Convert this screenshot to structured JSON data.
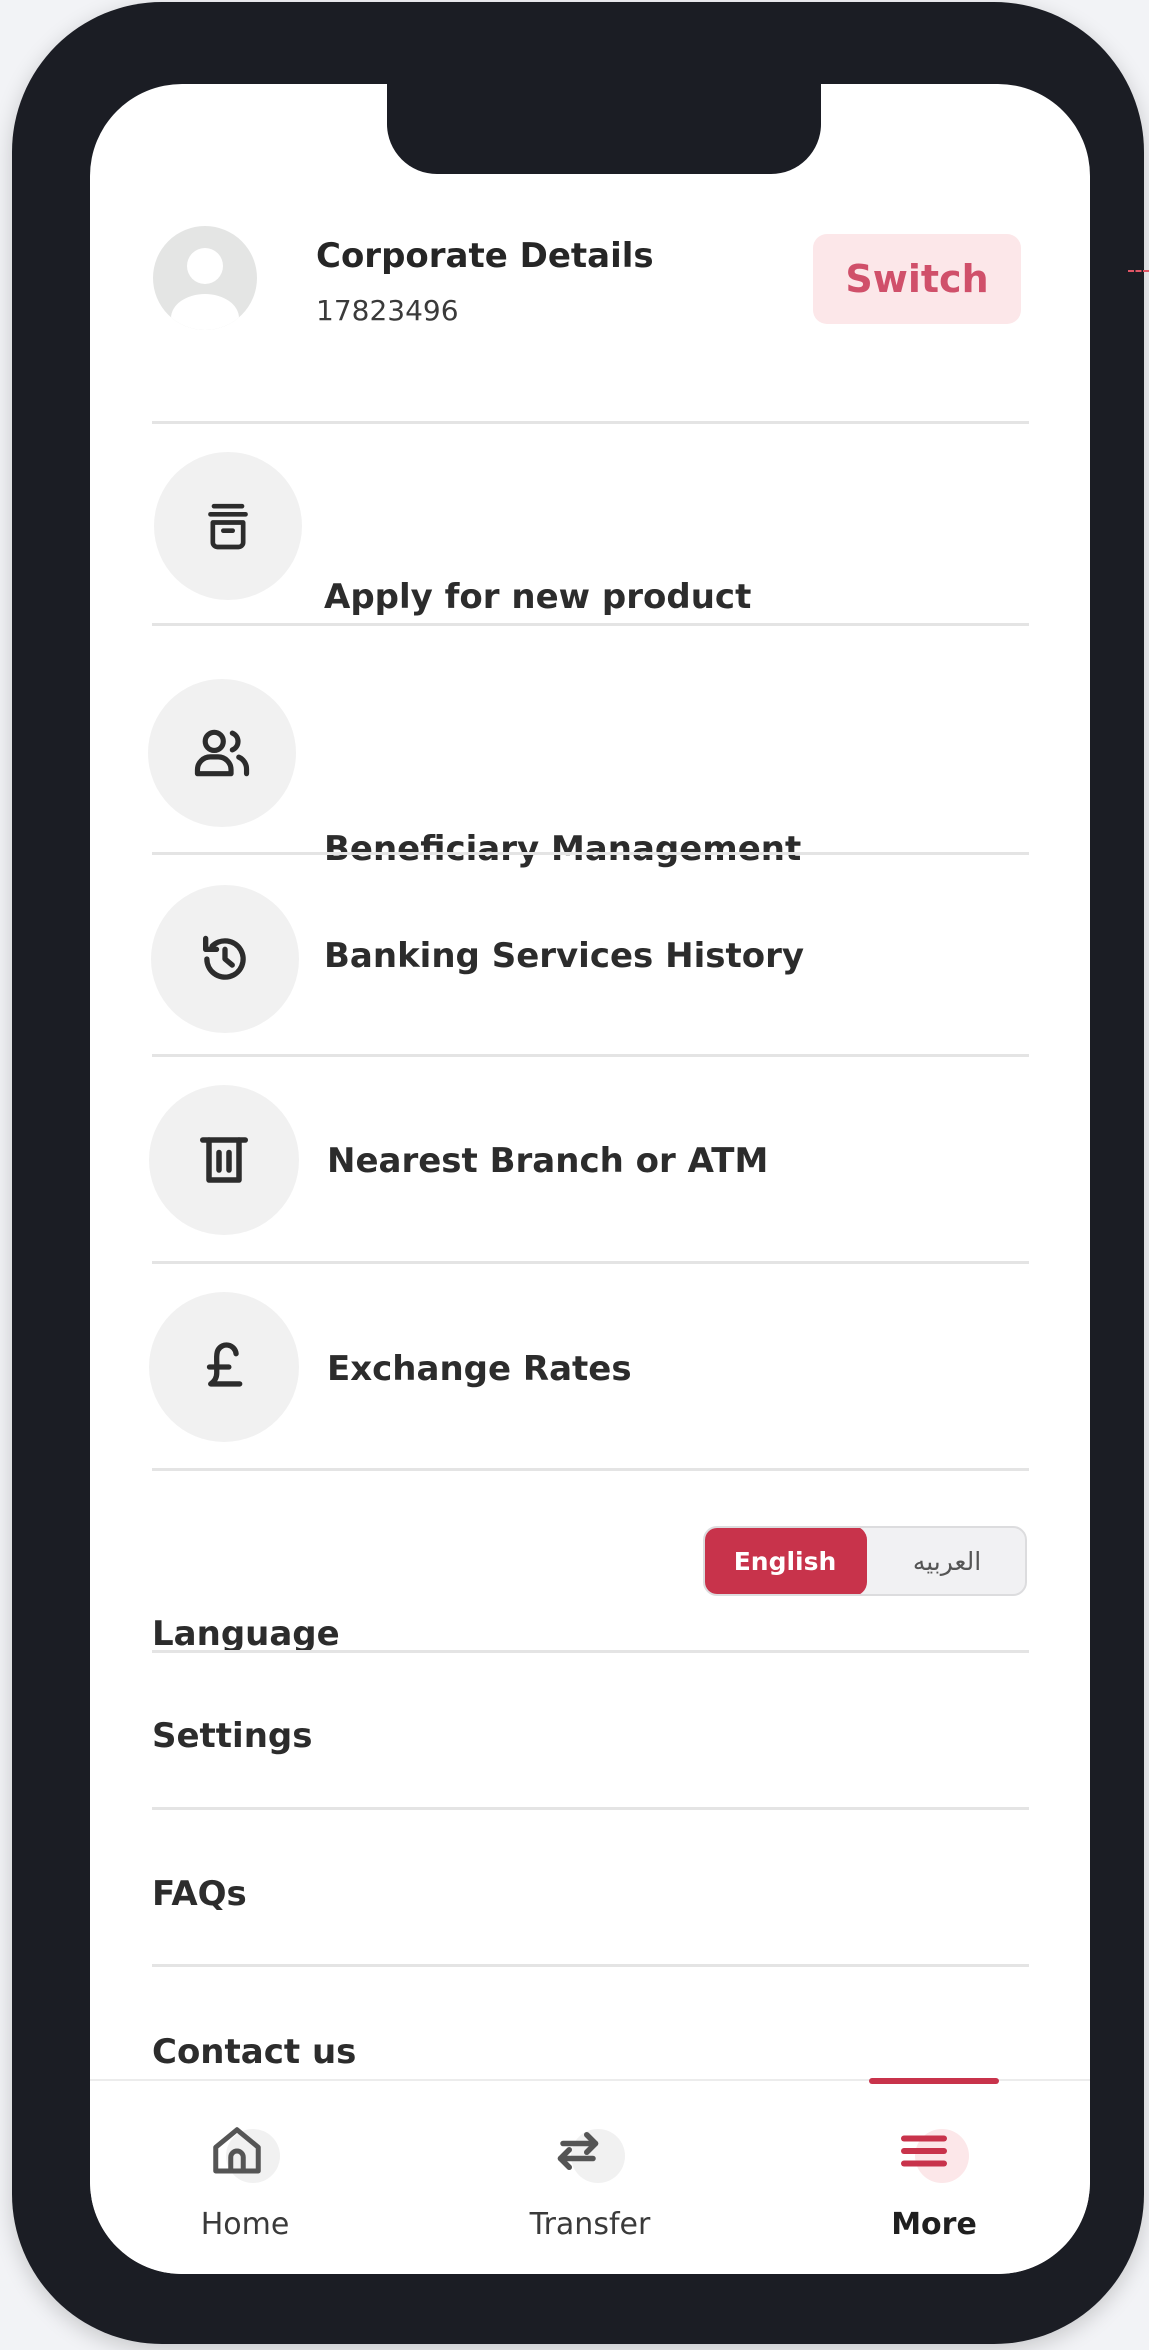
{
  "header": {
    "title": "Corporate Details",
    "account_id": "17823496",
    "switch_label": "Switch"
  },
  "menu": {
    "items": [
      {
        "label": "Apply for new product",
        "icon": "archive-box-icon"
      },
      {
        "label": "Beneficiary Management",
        "icon": "users-icon"
      },
      {
        "label": "Banking Services History",
        "icon": "history-clock-icon"
      },
      {
        "label": "Nearest Branch or ATM",
        "icon": "atm-icon"
      },
      {
        "label": "Exchange Rates",
        "icon": "pound-sterling-icon"
      }
    ]
  },
  "language": {
    "label": "Language",
    "options": [
      "English",
      "العربيه"
    ],
    "selected": "English"
  },
  "links": {
    "settings": "Settings",
    "faqs": "FAQs",
    "contact": "Contact us"
  },
  "bottom_nav": {
    "tabs": [
      {
        "label": "Home",
        "icon": "home-icon"
      },
      {
        "label": "Transfer",
        "icon": "transfer-arrows-icon"
      },
      {
        "label": "More",
        "icon": "menu-icon"
      }
    ],
    "active": "More"
  },
  "colors": {
    "accent": "#c8334b",
    "switch_background": "#fce7e9",
    "switch_text": "#d0506a",
    "frame": "#1b1d24"
  }
}
